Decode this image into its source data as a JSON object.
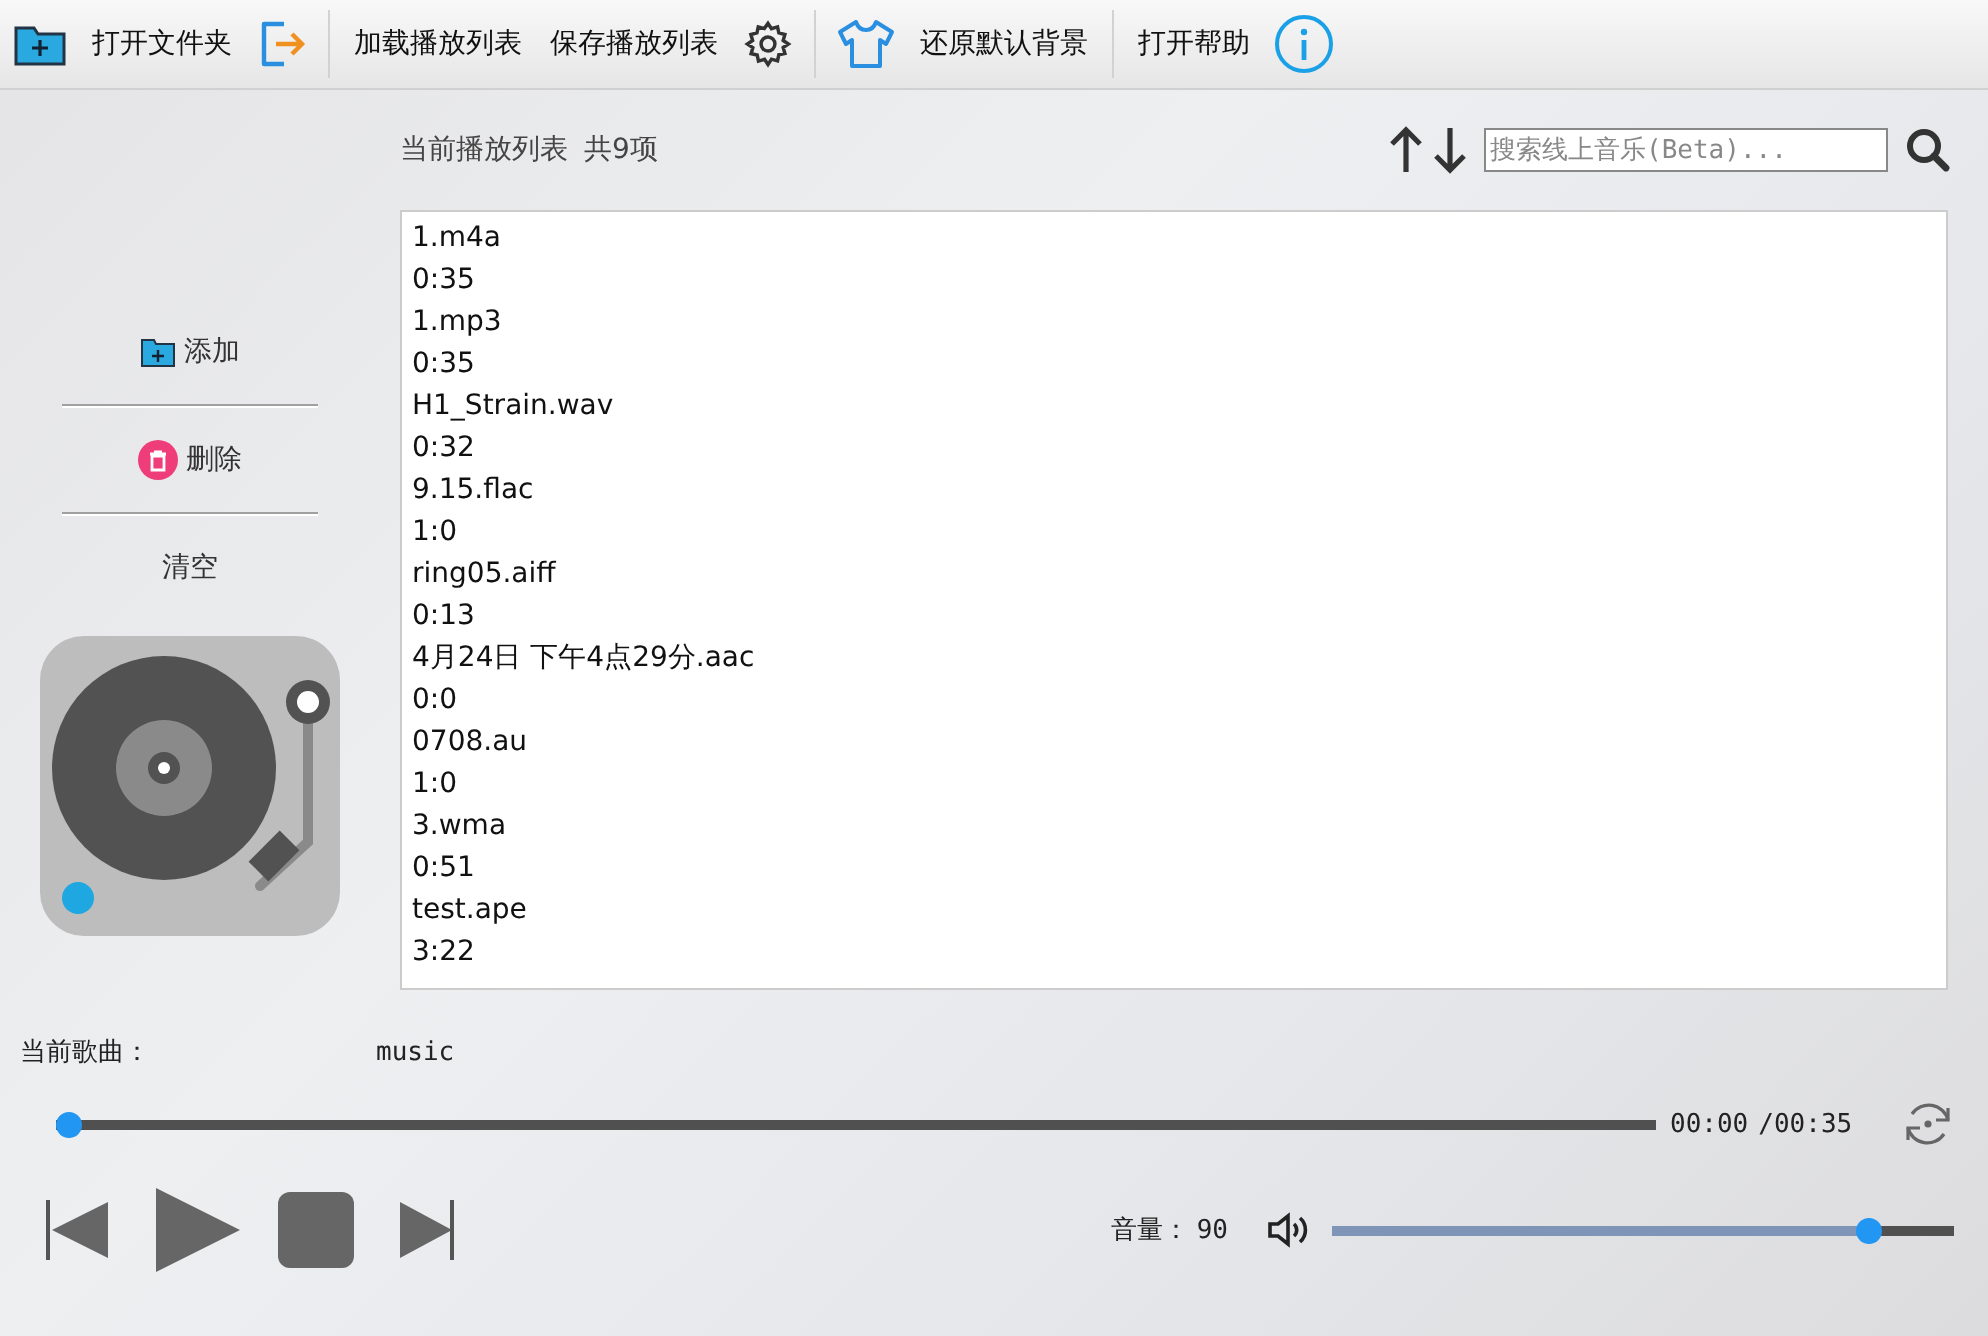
{
  "toolbar": [
    {
      "kind": "folder"
    },
    {
      "kind": "text",
      "label": "打开文件夹"
    },
    {
      "kind": "import"
    },
    {
      "kind": "divider"
    },
    {
      "kind": "text",
      "label": "加载播放列表"
    },
    {
      "kind": "text",
      "label": "保存播放列表"
    },
    {
      "kind": "gear"
    },
    {
      "kind": "divider"
    },
    {
      "kind": "shirt"
    },
    {
      "kind": "text",
      "label": "还原默认背景"
    },
    {
      "kind": "divider"
    },
    {
      "kind": "text",
      "label": "打开帮助"
    },
    {
      "kind": "info"
    }
  ],
  "sidebar": {
    "items": [
      {
        "kind": "add",
        "label": "添加"
      },
      {
        "kind": "delete",
        "label": "删除"
      },
      {
        "kind": "plain",
        "label": "清空"
      }
    ]
  },
  "playlist": {
    "title": "当前播放列表",
    "count": "共9项",
    "search": {
      "placeholder": "搜索线上音乐(Beta)..."
    },
    "items": [
      "1.m4a",
      "0:35",
      "1.mp3",
      "0:35",
      "H1_Strain.wav",
      "0:32",
      "9.15.flac",
      "1:0",
      "ring05.aiff",
      "0:13",
      "4月24日 下午4点29分.aac",
      "0:0",
      "0708.au",
      "1:0",
      "3.wma",
      "0:51",
      "test.ape",
      "3:22"
    ]
  },
  "now_playing": {
    "label": "当前歌曲：",
    "title": "music"
  },
  "progress": {
    "level": 0,
    "elapsed": "00:00",
    "total": "/00:35"
  },
  "volume": {
    "label": "音量：",
    "reading": "90",
    "level": 0.88
  }
}
